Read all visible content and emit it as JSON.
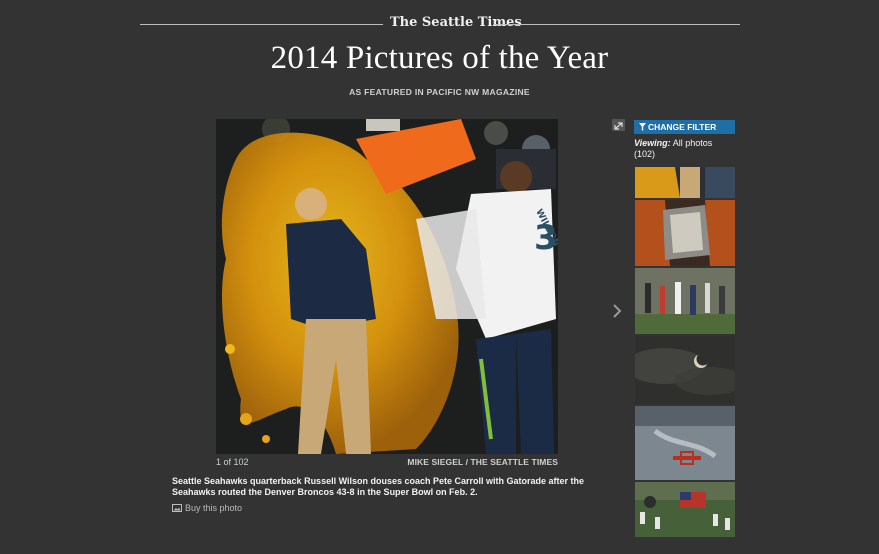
{
  "masthead": {
    "logo_text": "The Seattle Times"
  },
  "header": {
    "title": "2014 Pictures of the Year",
    "subtitle": "AS FEATURED IN PACIFIC NW MAGAZINE"
  },
  "photo": {
    "counter": "1 of 102",
    "credit": "MIKE SIEGEL / THE SEATTLE TIMES",
    "caption": "Seattle Seahawks quarterback Russell Wilson douses coach Pete Carroll with Gatorade after the Seahawks routed the Denver Broncos 43-8 in the Super Bowl on Feb. 2.",
    "jersey_number": "3",
    "jersey_name": "WILSON",
    "icons": {
      "expand": "expand-icon",
      "next": "chevron-right-icon"
    }
  },
  "actions": {
    "buy_label": "Buy this photo",
    "buy_icon": "image-icon"
  },
  "sidebar": {
    "filter_label": "CHANGE FILTER",
    "viewing_label": "Viewing:",
    "viewing_value": "All photos (102)",
    "thumbnails": [
      "thumbnail-gatorade-dunk",
      "thumbnail-book-hands",
      "thumbnail-rain-crowd",
      "thumbnail-eclipse",
      "thumbnail-air-show",
      "thumbnail-flags-cemetery"
    ]
  },
  "colors": {
    "background": "#333333",
    "accent": "#1d6fa5",
    "text": "#ffffff"
  }
}
